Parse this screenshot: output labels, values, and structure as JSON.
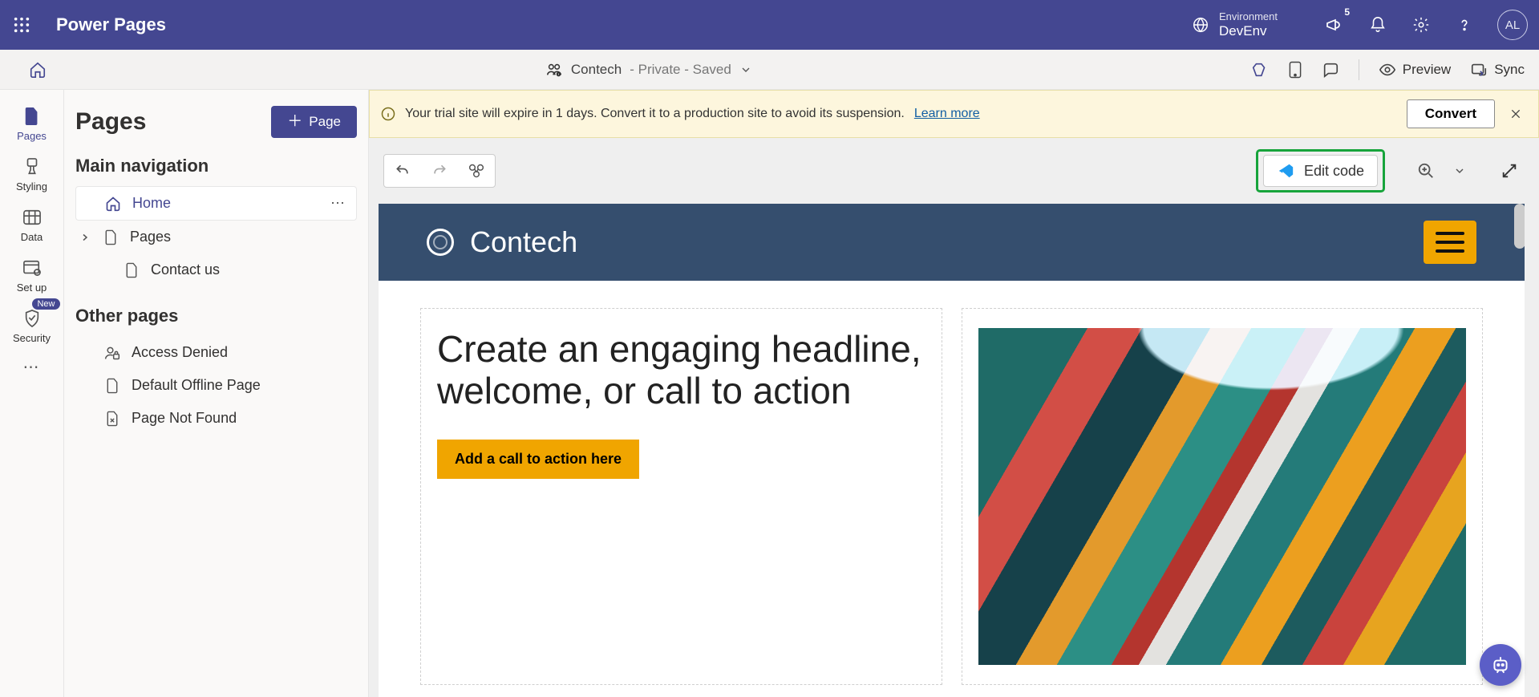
{
  "topbar": {
    "app_title": "Power Pages",
    "environment_label": "Environment",
    "environment_name": "DevEnv",
    "notification_badge": "5",
    "avatar_initials": "AL"
  },
  "secondbar": {
    "site_name": "Contech",
    "site_status": " - Private - Saved",
    "preview_label": "Preview",
    "sync_label": "Sync"
  },
  "rail": {
    "items": [
      {
        "label": "Pages"
      },
      {
        "label": "Styling"
      },
      {
        "label": "Data"
      },
      {
        "label": "Set up"
      },
      {
        "label": "Security",
        "pill": "New"
      }
    ]
  },
  "sidebar": {
    "title": "Pages",
    "add_button": "Page",
    "main_nav_header": "Main navigation",
    "home_label": "Home",
    "pages_label": "Pages",
    "contact_label": "Contact us",
    "other_header": "Other pages",
    "other_items": [
      "Access Denied",
      "Default Offline Page",
      "Page Not Found"
    ]
  },
  "banner": {
    "text": "Your trial site will expire in 1 days. Convert it to a production site to avoid its suspension. ",
    "learn_more": "Learn more",
    "convert_label": "Convert"
  },
  "edittb": {
    "edit_code_label": "Edit code"
  },
  "preview_site": {
    "brand": "Contech",
    "headline": "Create an engaging headline, welcome, or call to action",
    "cta": "Add a call to action here"
  }
}
